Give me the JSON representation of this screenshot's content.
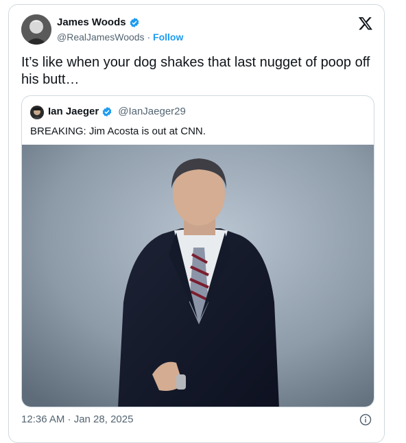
{
  "author": {
    "name": "James Woods",
    "handle": "@RealJamesWoods",
    "separator": "·",
    "follow_label": "Follow",
    "avatar_icon": "profile-photo"
  },
  "tweet": {
    "text": "It’s like when your dog shakes that last nugget of poop off his butt…",
    "timestamp": "12:36 AM · Jan 28, 2025"
  },
  "quoted": {
    "name": "Ian Jaeger",
    "handle": "@IanJaeger29",
    "text": "BREAKING: Jim Acosta is out at CNN."
  },
  "colors": {
    "link": "#1d9bf0",
    "secondary_text": "#536471",
    "border": "#cfd9de"
  }
}
